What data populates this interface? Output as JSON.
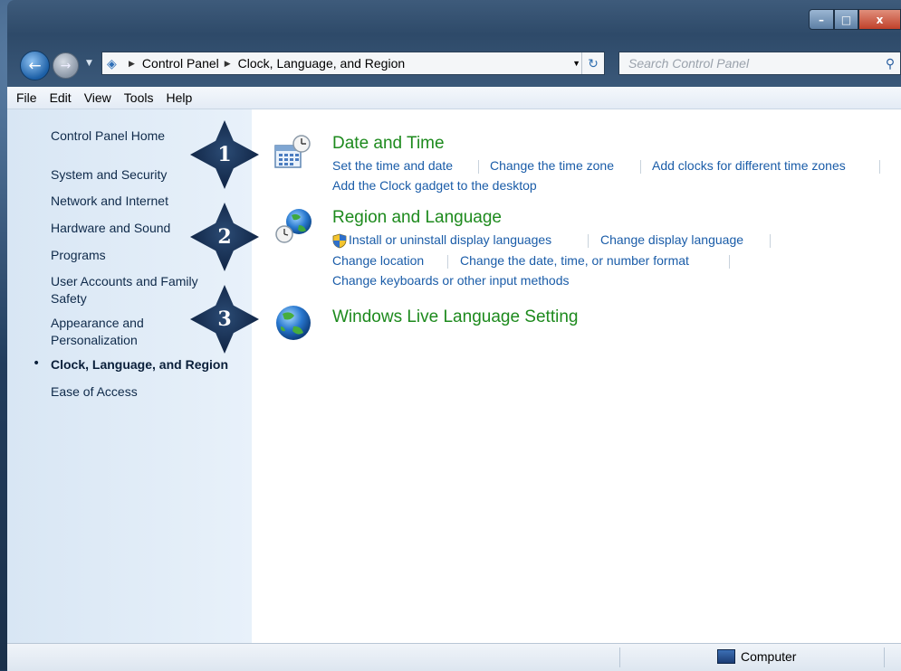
{
  "window": {
    "controls": {
      "minimize": "–",
      "maximize": "□",
      "close": "x"
    }
  },
  "nav": {
    "back_icon": "←",
    "forward_icon": "→",
    "breadcrumb": [
      "Control Panel",
      "Clock, Language, and Region"
    ],
    "search_placeholder": "Search Control Panel"
  },
  "menu": [
    "File",
    "Edit",
    "View",
    "Tools",
    "Help"
  ],
  "sidebar": {
    "items": [
      "Control Panel Home",
      "System and Security",
      "Network and Internet",
      "Hardware and Sound",
      "Programs",
      "User Accounts and Family\nSafety",
      "Appearance and\nPersonalization",
      "Clock, Language, and Region",
      "Ease of Access"
    ],
    "current_index": 7,
    "bullet": "•"
  },
  "categories": [
    {
      "title": "Date and Time",
      "icon": "calendar-clock-icon",
      "links": [
        "Set the time and date",
        "Change the time zone",
        "Add clocks for different time zones",
        "Add the Clock gadget to the desktop"
      ]
    },
    {
      "title": "Region and Language",
      "icon": "globe-clock-icon",
      "links": [
        "Install or uninstall display languages",
        "Change display language",
        "Change location",
        "Change the date, time, or number format",
        "Change keyboards or other input methods"
      ]
    },
    {
      "title": "Windows Live Language Setting",
      "icon": "globe-icon",
      "links": []
    }
  ],
  "callouts": [
    "1",
    "2",
    "3"
  ],
  "status": {
    "computer": "Computer"
  },
  "colors": {
    "category_title": "#1d8a1d",
    "link": "#1a5ca8",
    "sidebar_text": "#0f2a4a"
  }
}
